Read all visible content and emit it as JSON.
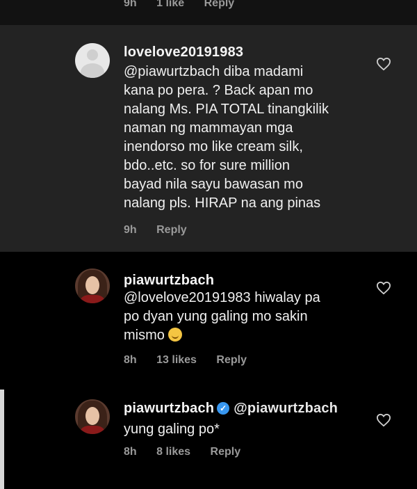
{
  "top_meta": {
    "time": "9h",
    "likes": "1 like",
    "reply": "Reply"
  },
  "comments": [
    {
      "username": "lovelove20191983",
      "lines": [
        "@piawurtzbach diba madami",
        "kana po pera. ? Back apan mo",
        "nalang Ms. PIA TOTAL tinangkilik",
        "naman ng mammayan mga",
        "inendorso mo like cream silk,",
        "bdo..etc. so for sure million",
        "bayad nila sayu bawasan mo",
        "nalang pls. HIRAP na ang pinas"
      ],
      "time": "9h",
      "reply": "Reply",
      "avatar_icon": "default-avatar-icon"
    },
    {
      "username": "piawurtzbach",
      "lines": [
        "@lovelove20191983 hiwalay pa",
        "po dyan yung galing mo sakin",
        "mismo"
      ],
      "emoji": "smiling-face-emoji",
      "time": "8h",
      "likes": "13 likes",
      "reply": "Reply",
      "avatar_icon": "profile-photo"
    },
    {
      "username": "piawurtzbach",
      "verified_icon": "verified-badge-icon",
      "mention": "@piawurtzbach",
      "line2": "yung galing po*",
      "time": "8h",
      "likes": "8 likes",
      "reply": "Reply",
      "avatar_icon": "profile-photo"
    }
  ],
  "colors": {
    "background": "#000000",
    "highlight": "#232323",
    "meta": "#9a9a9a",
    "verified": "#3897f0"
  }
}
